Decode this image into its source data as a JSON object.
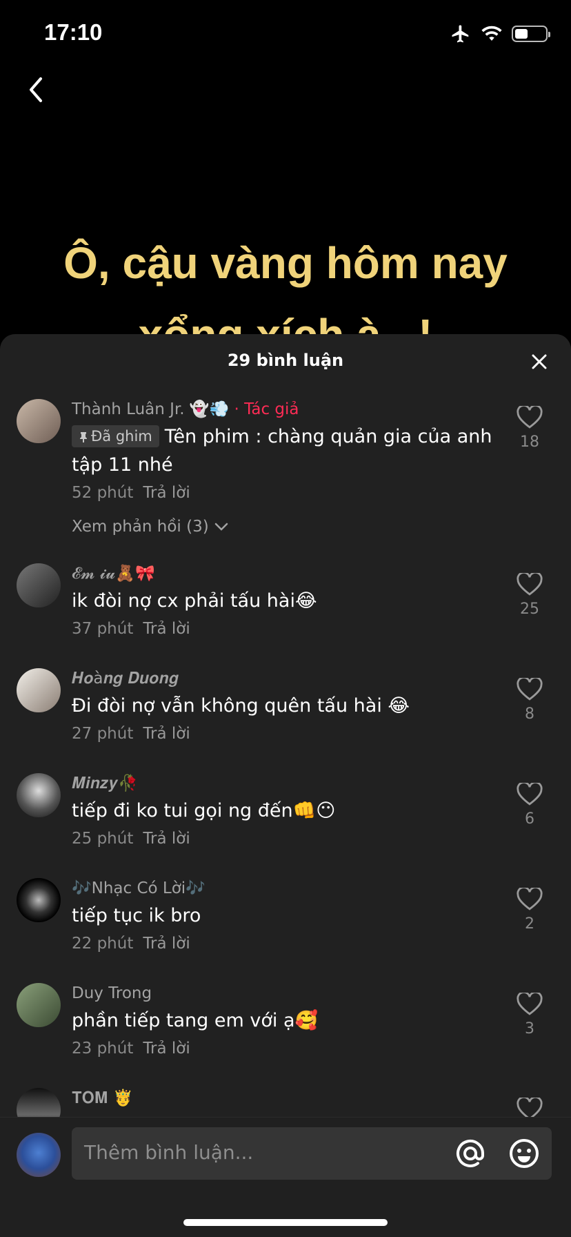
{
  "status_bar": {
    "time": "17:10",
    "icons": [
      "airplane-icon",
      "wifi-icon",
      "battery-icon"
    ],
    "battery_level": 0.4
  },
  "video": {
    "caption_line1": "Ô, cậu vàng hôm nay",
    "caption_line2": "xổng xích à...!"
  },
  "sheet": {
    "title": "29 bình luận"
  },
  "comments": [
    {
      "user": "Thành Luân Jr. 👻💨",
      "author_tag": "· Tác giả",
      "pinned_label": "Đã ghim",
      "text": "Tên phim : chàng quản gia của anh tập 11 nhé",
      "time": "52 phút",
      "reply": "Trả lời",
      "likes": "18",
      "view_replies": "Xem phản hồi (3)"
    },
    {
      "user": "𝓔𝓶 𝓲𝓾🧸🎀",
      "text": "ik đòi nợ cx phải tấu hài😂",
      "time": "37 phút",
      "reply": "Trả lời",
      "likes": "25"
    },
    {
      "user": "𝑯𝒐à𝒏𝒈 𝑫𝒖𝒐𝒏𝒈",
      "text": "Đi đòi nợ vẫn không quên tấu hài 😂",
      "time": "27 phút",
      "reply": "Trả lời",
      "likes": "8"
    },
    {
      "user": "𝑴𝒊𝒏𝒛𝒚🥀",
      "text": "tiếp đi ko tui gọi ng đến👊😶",
      "time": "25 phút",
      "reply": "Trả lời",
      "likes": "6"
    },
    {
      "user": "🎶Nhạc Có Lời🎶",
      "text": "tiếp tục ik bro",
      "time": "22 phút",
      "reply": "Trả lời",
      "likes": "2"
    },
    {
      "user": "Duy Trong",
      "text": "phần tiếp tang em với ạ🥰",
      "time": "23 phút",
      "reply": "Trả lời",
      "likes": "3"
    },
    {
      "user": "𝐓𝐎𝐌 🤴",
      "text": "",
      "time": "",
      "reply": "",
      "likes": ""
    }
  ],
  "input": {
    "placeholder": "Thêm bình luận..."
  },
  "colors": {
    "sheet_bg": "#212121",
    "caption": "#f0d37a",
    "author_tag": "#fe2c55"
  }
}
